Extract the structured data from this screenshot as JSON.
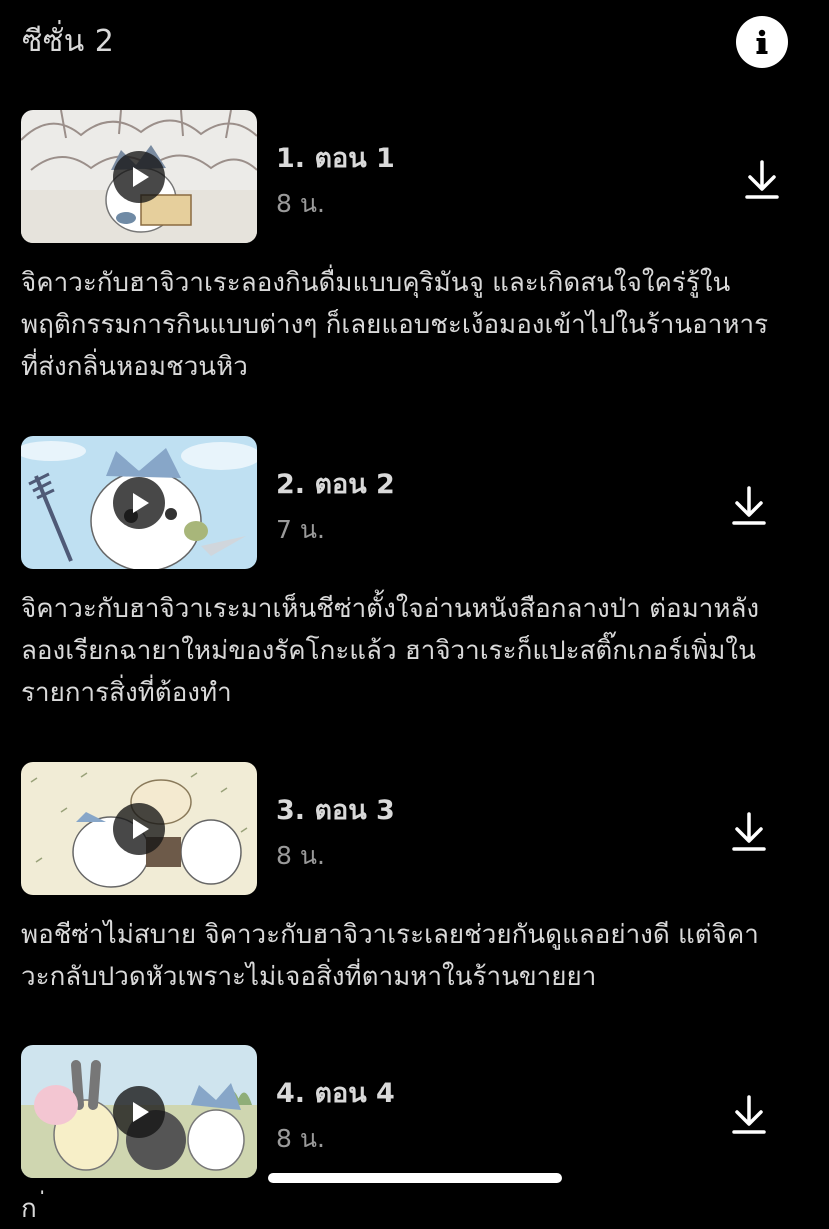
{
  "header": {
    "season_label": "ซีซั่น 2",
    "info_icon": "info-icon"
  },
  "episodes": [
    {
      "title": "1. ตอน 1",
      "duration": "8 น.",
      "description": "จิคาวะกับฮาจิวาเระลองกินดื่มแบบคุริมันจู และเกิดสนใจใคร่รู้ใน พฤติกรรมการกินแบบต่างๆ ก็เลยแอบชะเง้อมองเข้าไปในร้านอาหาร ที่ส่งกลิ่นหอมชวนหิว",
      "lines": [
        "จิคาวะกับฮาจิวาเระลองกินดื่มแบบคุริมันจู และเกิดสนใจใคร่รู้ใน",
        "พฤติกรรมการกินแบบต่างๆ ก็เลยแอบชะเง้อมองเข้าไปในร้านอาหาร",
        "ที่ส่งกลิ่นหอมชวนหิว"
      ]
    },
    {
      "title": "2. ตอน 2",
      "duration": "7 น.",
      "lines": [
        "จิคาวะกับฮาจิวาเระมาเห็นชีซ่าตั้งใจอ่านหนังสือกลางป่า ต่อมาหลัง",
        "ลองเรียกฉายาใหม่ของรัคโกะแล้ว ฮาจิวาเระก็แปะสติ๊กเกอร์เพิ่มใน",
        "รายการสิ่งที่ต้องทำ"
      ]
    },
    {
      "title": "3. ตอน 3",
      "duration": "8 น.",
      "lines": [
        "พอชีซ่าไม่สบาย จิคาวะกับฮาจิวาเระเลยช่วยกันดูแลอย่างดี แต่จิคา",
        "วะกลับปวดหัวเพราะไม่เจอสิ่งที่ตามหาในร้านขายยา"
      ]
    },
    {
      "title": "4. ตอน 4",
      "duration": "8 น."
    }
  ],
  "partial_next_text": "ก ่",
  "colors": {
    "background": "#000000",
    "text": "#d9d9d9",
    "muted": "#9a9a9a"
  }
}
